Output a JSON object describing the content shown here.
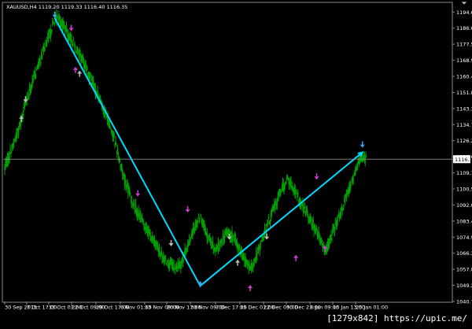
{
  "header": {
    "info": "XAUUSD,H4 1119.20 1119.33 1116.40 1116.35"
  },
  "watermark": "[1279x842] https://upic.me/",
  "colors": {
    "background": "#000000",
    "candles": "#00a000",
    "frame": "#8a8a8a",
    "trend": "#00d8ff",
    "price_line": "#9a9a9a",
    "arrow_sell_magenta": "#d040d0",
    "arrow_buy_blue": "#3aa8ff",
    "arrow_neutral": "#bdbdbd",
    "watermark_bg": "#000000"
  },
  "icons": [
    "chart-menu-triangle-icon",
    "arrow-up-icon",
    "arrow-down-icon"
  ],
  "chart_data": {
    "type": "line",
    "symbol": "XAUUSD",
    "timeframe": "H4",
    "current_price": "1116.35",
    "y_ticks": [
      "1194.60",
      "1186.05",
      "1177.50",
      "1168.95",
      "1160.40",
      "1151.85",
      "1143.30",
      "1134.75",
      "1126.20",
      "1117.65",
      "1109.10",
      "1100.55",
      "1092.00",
      "1083.45",
      "1074.90",
      "1066.35",
      "1057.80",
      "1049.25",
      "1040.70"
    ],
    "x_ticks": [
      "30 Sep 2015",
      "7 Oct 17:00",
      "15 Oct 01:00",
      "22 Oct 09:00",
      "29 Oct 17:00",
      "6 Nov 01:00",
      "13 Nov 09:00",
      "20 Nov 17:00",
      "30 Nov 09:00",
      "7 Dec 17:00",
      "15 Dec 01:00",
      "22 Dec 09:00",
      "30 Dec 21:00",
      "8 Jan 09:00",
      "15 Jan 13:00",
      "25 Jan 01:00"
    ],
    "ylim": [
      1040.7,
      1198.5
    ],
    "series": [
      {
        "values": [
          1112,
          1118,
          1124,
          1130,
          1138,
          1146,
          1152,
          1160,
          1166,
          1172,
          1178,
          1184,
          1190,
          1192,
          1188,
          1184,
          1180,
          1176,
          1172,
          1168,
          1162,
          1158,
          1152,
          1148,
          1142,
          1136,
          1130,
          1122,
          1112,
          1104,
          1098,
          1092,
          1088,
          1084,
          1080,
          1076,
          1072,
          1068,
          1064,
          1062,
          1060,
          1058,
          1060,
          1064,
          1070,
          1076,
          1082,
          1086,
          1080,
          1074,
          1070,
          1068,
          1072,
          1076,
          1078,
          1074,
          1070,
          1066,
          1062,
          1058,
          1062,
          1068,
          1074,
          1080,
          1086,
          1092,
          1098,
          1102,
          1106,
          1102,
          1098,
          1094,
          1090,
          1086,
          1082,
          1078,
          1072,
          1068,
          1072,
          1078,
          1084,
          1090,
          1096,
          1102,
          1108,
          1114,
          1118,
          1116
        ],
        "candle_range": 1.2
      }
    ],
    "trendlines": [
      {
        "from": [
          "15 Oct",
          1191.5
        ],
        "to": [
          "30 Nov",
          1049.0
        ]
      },
      {
        "from": [
          "30 Nov",
          1049.0
        ],
        "to": [
          "25 Jan",
          1120.0
        ]
      }
    ],
    "arrows": [
      {
        "type": "sell",
        "i": 12,
        "price": 1194.0,
        "color": "blue"
      },
      {
        "type": "sell",
        "i": 16,
        "price": 1187.0,
        "color": "magenta"
      },
      {
        "type": "buy",
        "i": 4,
        "price": 1137.0,
        "color": "neutral"
      },
      {
        "type": "sell",
        "i": 5,
        "price": 1149.0,
        "color": "neutral"
      },
      {
        "type": "buy",
        "i": 17,
        "price": 1163.0,
        "color": "magenta"
      },
      {
        "type": "buy",
        "i": 18,
        "price": 1161.0,
        "color": "neutral"
      },
      {
        "type": "sell",
        "i": 32,
        "price": 1099.0,
        "color": "magenta"
      },
      {
        "type": "sell",
        "i": 40,
        "price": 1072.5,
        "color": "neutral"
      },
      {
        "type": "sell",
        "i": 44,
        "price": 1090.5,
        "color": "magenta"
      },
      {
        "type": "buy",
        "i": 47,
        "price": 1049.0,
        "color": "blue"
      },
      {
        "type": "sell",
        "i": 54,
        "price": 1076.0,
        "color": "neutral"
      },
      {
        "type": "buy",
        "i": 56,
        "price": 1060.5,
        "color": "neutral"
      },
      {
        "type": "buy",
        "i": 59,
        "price": 1047.0,
        "color": "magenta"
      },
      {
        "type": "sell",
        "i": 63,
        "price": 1076.0,
        "color": "neutral"
      },
      {
        "type": "buy",
        "i": 70,
        "price": 1063.0,
        "color": "magenta"
      },
      {
        "type": "sell",
        "i": 75,
        "price": 1108.0,
        "color": "magenta"
      },
      {
        "type": "buy",
        "i": 77,
        "price": 1068.0,
        "color": "magenta"
      },
      {
        "type": "sell",
        "i": 86,
        "price": 1125.0,
        "color": "blue"
      }
    ]
  }
}
